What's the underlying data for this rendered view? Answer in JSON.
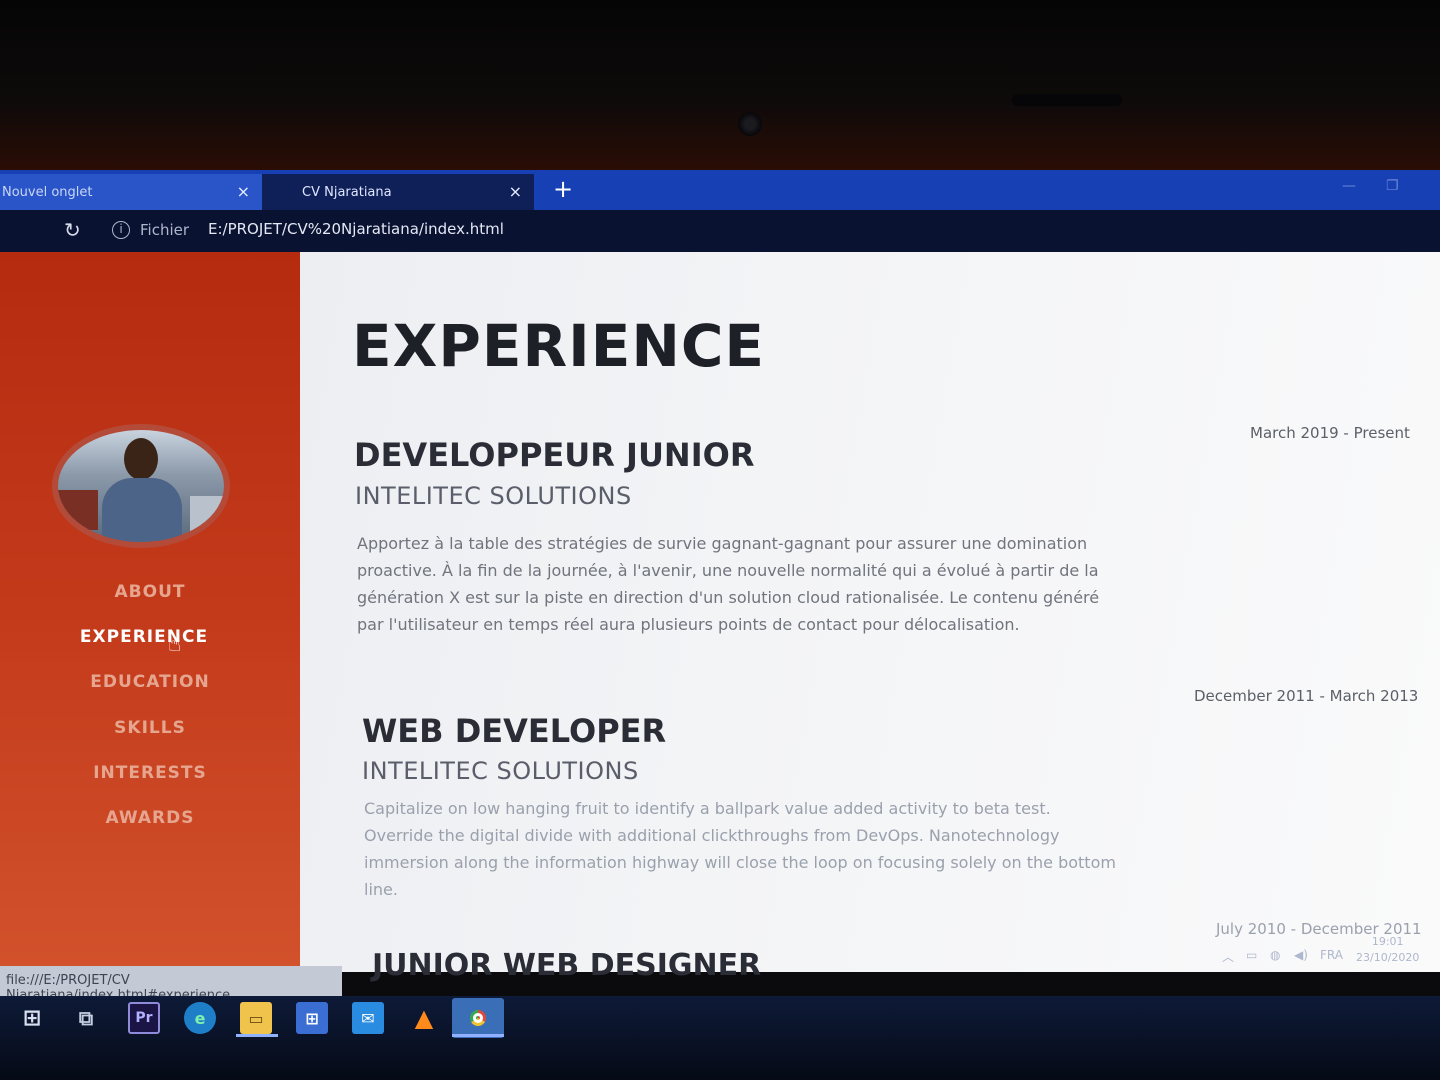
{
  "browser": {
    "tabs": [
      {
        "label": "Nouvel onglet",
        "active": false
      },
      {
        "label": "CV Njaratiana",
        "active": true
      }
    ],
    "new_tab_icon": "+",
    "close_icon": "×",
    "security_label": "Fichier",
    "url": "E:/PROJET/CV%20Njaratiana/index.html",
    "status_url": "file:///E:/PROJET/CV Njaratiana/index.html#experience"
  },
  "sidebar": {
    "nav": [
      {
        "label": "ABOUT",
        "active": false
      },
      {
        "label": "EXPERIENCE",
        "active": true
      },
      {
        "label": "EDUCATION",
        "active": false
      },
      {
        "label": "SKILLS",
        "active": false
      },
      {
        "label": "INTERESTS",
        "active": false
      },
      {
        "label": "AWARDS",
        "active": false
      }
    ]
  },
  "main": {
    "heading": "EXPERIENCE",
    "jobs": [
      {
        "title": "DEVELOPPEUR JUNIOR",
        "company": "INTELITEC SOLUTIONS",
        "date": "March 2019 - Present",
        "description": "Apportez à la table des stratégies de survie gagnant-gagnant pour assurer une domination proactive. À la fin de la journée, à l'avenir, une nouvelle normalité qui a évolué à partir de la génération X est sur la piste en direction d'un solution cloud rationalisée. Le contenu généré par l'utilisateur en temps réel aura plusieurs points de contact pour délocalisation."
      },
      {
        "title": "WEB DEVELOPER",
        "company": "INTELITEC SOLUTIONS",
        "date": "December 2011 - March 2013",
        "description": "Capitalize on low hanging fruit to identify a ballpark value added activity to beta test. Override the digital divide with additional clickthroughs from DevOps. Nanotechnology immersion along the information highway will close the loop on focusing solely on the bottom line."
      },
      {
        "title": "JUNIOR WEB DESIGNER",
        "company": "",
        "date": "July 2010 - December 2011",
        "description": ""
      }
    ]
  },
  "taskbar": {
    "apps": [
      "windows-start-icon",
      "task-view-icon",
      "premiere-icon",
      "edge-icon",
      "file-explorer-icon",
      "store-icon",
      "mail-icon",
      "vlc-icon",
      "chrome-icon"
    ],
    "premiere_label": "Pr",
    "language": "FRA",
    "time": "19:01",
    "date": "23/10/2020"
  },
  "colors": {
    "sidebar_accent": "#c33a1b",
    "tab_strip": "#1740b5",
    "heading": "#1d2027"
  }
}
